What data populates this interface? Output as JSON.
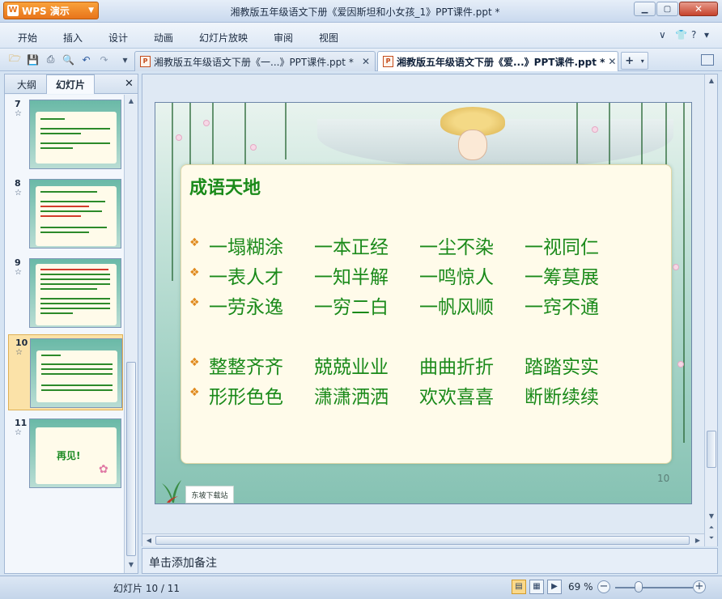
{
  "app": {
    "button_label": "WPS 演示",
    "title": "湘教版五年级语文下册《爱因斯坦和小女孩_1》PPT课件.ppt *"
  },
  "menu": {
    "items": [
      "开始",
      "插入",
      "设计",
      "动画",
      "幻灯片放映",
      "审阅",
      "视图"
    ]
  },
  "tabs": {
    "inactive_label": "湘教版五年级语文下册《一...》PPT课件.ppt *",
    "active_label": "湘教版五年级语文下册《爱...》PPT课件.ppt *",
    "new_tab_label": "+"
  },
  "sidebar": {
    "tab_outline": "大纲",
    "tab_slides": "幻灯片",
    "thumbnails": [
      {
        "num": "7"
      },
      {
        "num": "8"
      },
      {
        "num": "9"
      },
      {
        "num": "10"
      },
      {
        "num": "11",
        "text": "再见!"
      }
    ]
  },
  "slide": {
    "title": "成语天地",
    "rows": [
      [
        "一塌糊涂",
        "一本正经",
        "一尘不染",
        "一视同仁"
      ],
      [
        "一表人才",
        "一知半解",
        "一鸣惊人",
        "一筹莫展"
      ],
      [
        "一劳永逸",
        "一穷二白",
        "一帆风顺",
        "一窍不通"
      ],
      [
        "整整齐齐",
        "兢兢业业",
        "曲曲折折",
        "踏踏实实"
      ],
      [
        "形形色色",
        "潇潇洒洒",
        "欢欢喜喜",
        "断断续续"
      ]
    ],
    "page_number": "10",
    "footer_logo": "东坡下载站"
  },
  "notes": {
    "placeholder": "单击添加备注"
  },
  "status": {
    "slide_count": "幻灯片 10 / 11",
    "zoom": "69 %"
  },
  "colors": {
    "accent_orange": "#e8741b",
    "idiom_green": "#1a8a1a",
    "selected_thumb": "#fbe2a8"
  }
}
